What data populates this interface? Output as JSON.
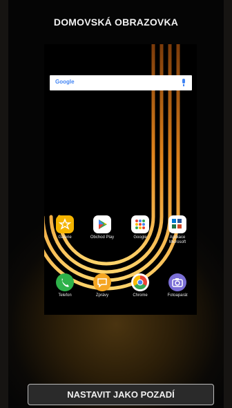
{
  "header": {
    "title": "DOMOVSKÁ OBRAZOVKA"
  },
  "preview": {
    "search_bar": {
      "logo": "Google",
      "mic_icon": "microphone-icon"
    },
    "apps_row1": [
      {
        "name": "Galerie",
        "icon": "galerie-icon",
        "color": "#f4b400"
      },
      {
        "name": "Obchod Play",
        "icon": "play-store-icon",
        "color": "#ffffff"
      },
      {
        "name": "Google",
        "icon": "google-folder-icon",
        "color": "#ffffff"
      },
      {
        "name": "Aplikace Microsoft",
        "icon": "microsoft-folder-icon",
        "color": "#ffffff"
      }
    ],
    "apps_row2": [
      {
        "name": "Telefon",
        "icon": "phone-icon",
        "color": "#2eb24a"
      },
      {
        "name": "Zprávy",
        "icon": "messages-icon",
        "color": "#f5a623"
      },
      {
        "name": "Chrome",
        "icon": "chrome-icon",
        "color": "#ffffff"
      },
      {
        "name": "Fotoaparát",
        "icon": "camera-icon",
        "color": "#7b6fd6"
      }
    ]
  },
  "action": {
    "set_wallpaper_label": "NASTAVIT JAKO POZADÍ"
  }
}
